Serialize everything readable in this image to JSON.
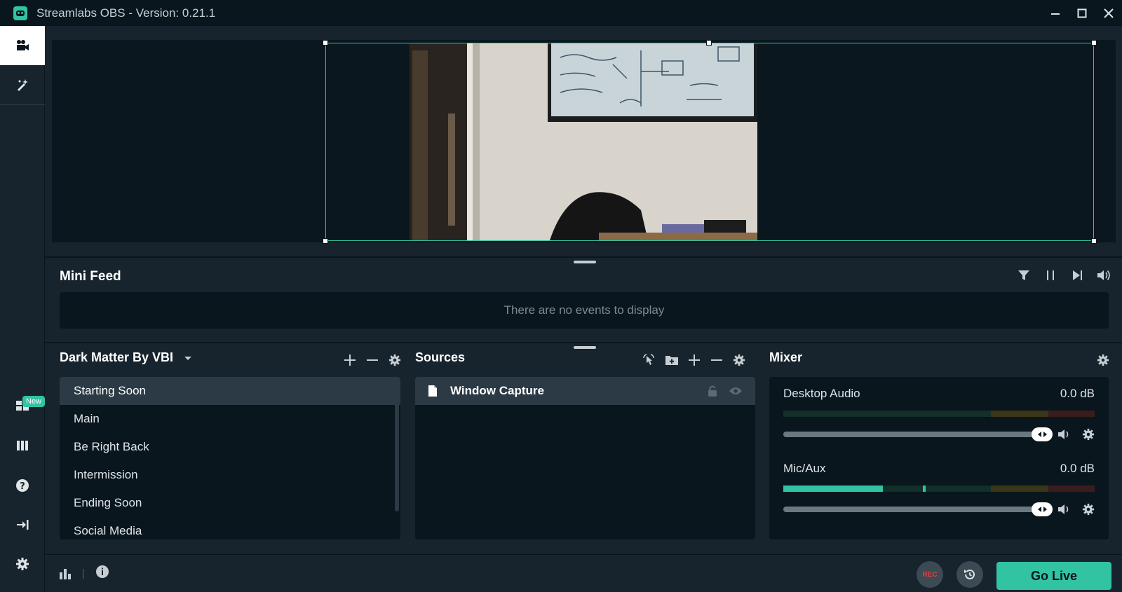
{
  "titlebar": {
    "title": "Streamlabs OBS - Version: 0.21.1",
    "logo_icon": "streamlabs-logo-icon",
    "controls": [
      "minimize-icon",
      "maximize-icon",
      "close-icon"
    ]
  },
  "sidebar": {
    "items": [
      {
        "icon": "studio-camera-icon",
        "active": true
      },
      {
        "icon": "themes-wand-icon"
      },
      {
        "icon": "layout-grid-icon",
        "badge": "New"
      },
      {
        "icon": "library-icon"
      },
      {
        "icon": "help-icon"
      },
      {
        "icon": "login-icon"
      },
      {
        "icon": "settings-gear-icon"
      }
    ]
  },
  "minifeed": {
    "title": "Mini Feed",
    "empty_message": "There are no events to display",
    "controls": [
      "filter-icon",
      "pause-icon",
      "skip-icon",
      "volume-icon"
    ]
  },
  "scenes": {
    "collection_name": "Dark Matter By VBI",
    "items": [
      "Starting Soon",
      "Main",
      "Be Right Back",
      "Intermission",
      "Ending Soon",
      "Social Media"
    ],
    "selected_index": 0
  },
  "sources": {
    "title": "Sources",
    "items": [
      {
        "name": "Window Capture",
        "icon": "file-icon"
      }
    ]
  },
  "mixer": {
    "title": "Mixer",
    "channels": [
      {
        "name": "Desktop Audio",
        "level": "0.0 dB",
        "meter_fill": 0.0,
        "volume": 1.0
      },
      {
        "name": "Mic/Aux",
        "level": "0.0 dB",
        "meter_fill": 0.32,
        "volume": 1.0
      }
    ]
  },
  "footer": {
    "rec_label": "REC",
    "go_live_label": "Go Live"
  },
  "colors": {
    "accent": "#31c3a2",
    "background": "#17242d",
    "panel": "#09161d",
    "selected": "#2b3a44",
    "rec": "#e04040"
  }
}
